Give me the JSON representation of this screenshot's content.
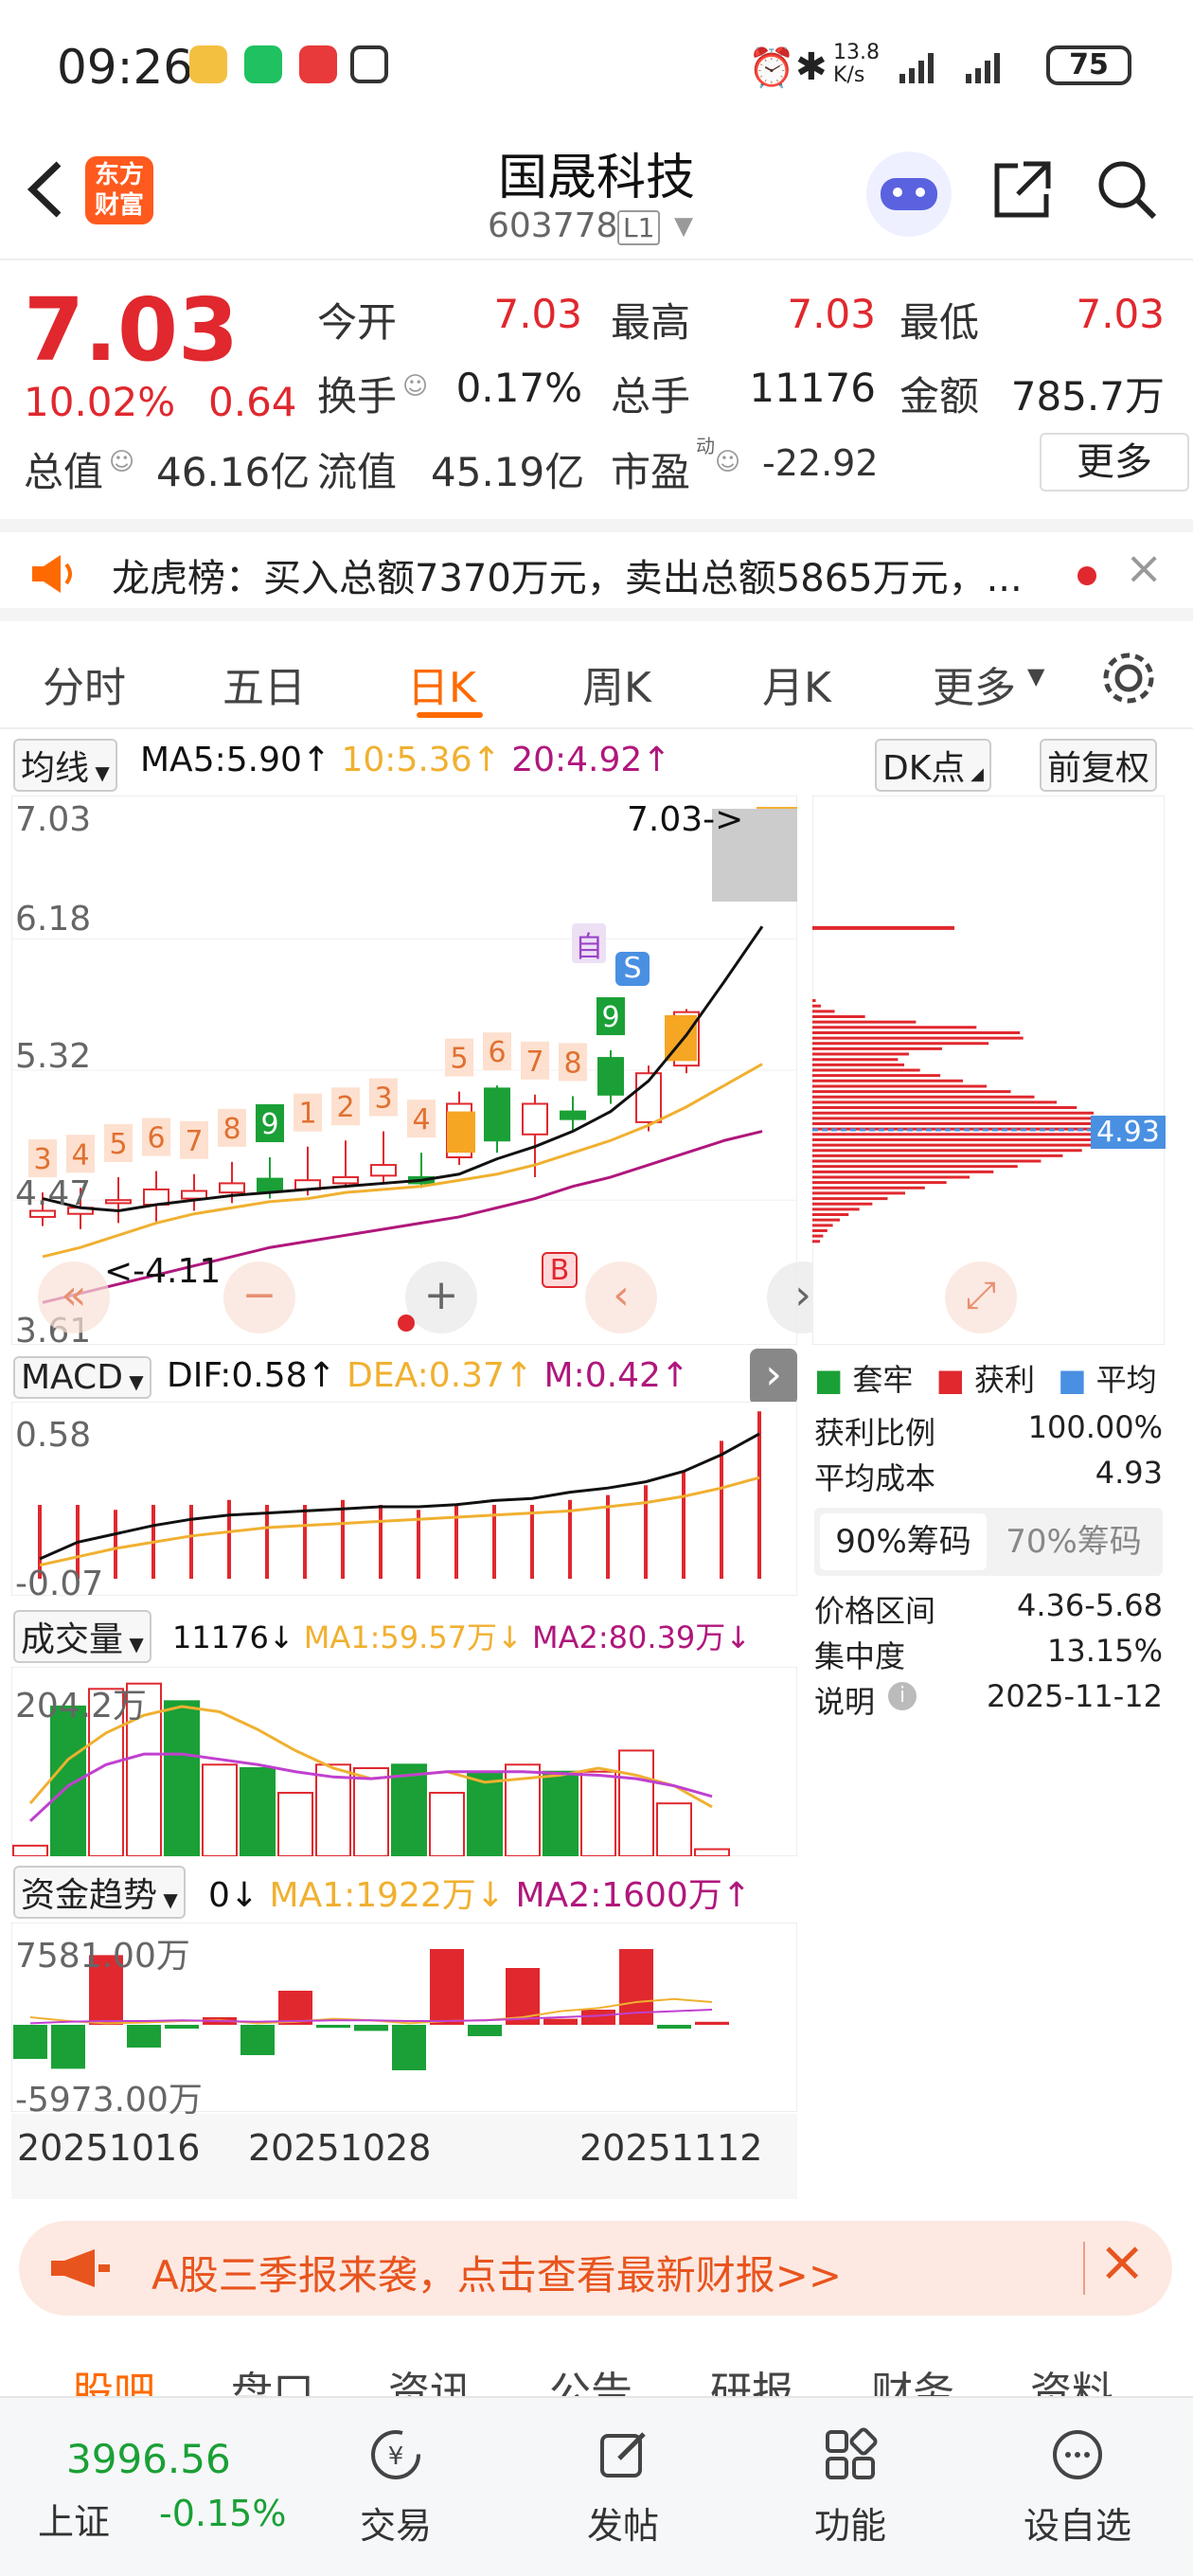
{
  "status_bar": {
    "time": "09:26",
    "net_speed": "13.8\nK/s",
    "battery": "75"
  },
  "header": {
    "logo_line1": "东方",
    "logo_line2": "财富",
    "title": "国晟科技",
    "code": "603778",
    "level": "L1"
  },
  "quote": {
    "price": "7.03",
    "change_pct": "10.02%",
    "change": "0.64",
    "open_label": "今开",
    "open": "7.03",
    "high_label": "最高",
    "high": "7.03",
    "low_label": "最低",
    "low": "7.03",
    "turnover_label": "换手",
    "turnover": "0.17%",
    "volume_label": "总手",
    "volume": "11176",
    "amount_label": "金额",
    "amount": "785.7万",
    "mcap_label": "总值",
    "mcap": "46.16亿",
    "float_label": "流值",
    "float": "45.19亿",
    "pe_label": "市盈",
    "pe_sup": "动",
    "pe": "-22.92",
    "more": "更多"
  },
  "dragon_tiger": {
    "text": "龙虎榜：买入总额7370万元，卖出总额5865万元，..."
  },
  "tabs": [
    "分时",
    "五日",
    "日K",
    "周K",
    "月K",
    "更多"
  ],
  "active_tab": "日K",
  "ma_legend": {
    "selector": "均线",
    "ma5": "MA5:5.90↑",
    "ma10": "10:5.36↑",
    "ma20": "20:4.92↑",
    "dk": "DK点",
    "fq": "前复权"
  },
  "kline": {
    "y_labels": [
      "7.03",
      "6.18",
      "5.32",
      "4.47",
      "3.61"
    ],
    "last_price_note": "7.03->",
    "low_note": "<-4.11",
    "marker_b": "B",
    "marker_s": "S",
    "marker_self": "自",
    "candles": [
      {
        "o": 4.36,
        "c": 4.4,
        "h": 4.52,
        "l": 4.3
      },
      {
        "o": 4.38,
        "c": 4.42,
        "h": 4.55,
        "l": 4.28
      },
      {
        "o": 4.45,
        "c": 4.47,
        "h": 4.62,
        "l": 4.32
      },
      {
        "o": 4.44,
        "c": 4.54,
        "h": 4.66,
        "l": 4.33
      },
      {
        "o": 4.48,
        "c": 4.53,
        "h": 4.64,
        "l": 4.4
      },
      {
        "o": 4.52,
        "c": 4.58,
        "h": 4.72,
        "l": 4.45
      },
      {
        "o": 4.61,
        "c": 4.53,
        "h": 4.75,
        "l": 4.48
      },
      {
        "o": 4.54,
        "c": 4.6,
        "h": 4.82,
        "l": 4.5
      },
      {
        "o": 4.58,
        "c": 4.62,
        "h": 4.86,
        "l": 4.55
      },
      {
        "o": 4.63,
        "c": 4.7,
        "h": 4.92,
        "l": 4.58
      },
      {
        "o": 4.62,
        "c": 4.58,
        "h": 4.78,
        "l": 4.55
      },
      {
        "o": 4.75,
        "c": 5.1,
        "h": 5.18,
        "l": 4.7
      },
      {
        "o": 5.2,
        "c": 4.86,
        "h": 5.22,
        "l": 4.78
      },
      {
        "o": 4.9,
        "c": 5.1,
        "h": 5.16,
        "l": 4.62
      },
      {
        "o": 5.05,
        "c": 5.0,
        "h": 5.15,
        "l": 4.92
      },
      {
        "o": 5.4,
        "c": 5.16,
        "h": 5.45,
        "l": 5.1
      },
      {
        "o": 4.98,
        "c": 5.3,
        "h": 5.35,
        "l": 4.92
      },
      {
        "o": 5.35,
        "c": 5.7,
        "h": 5.72,
        "l": 5.3
      },
      {
        "o": 7.03,
        "c": 7.03,
        "h": 7.03,
        "l": 7.03
      }
    ],
    "nine_turn": [
      {
        "i": 0,
        "v": "3"
      },
      {
        "i": 1,
        "v": "4"
      },
      {
        "i": 2,
        "v": "5"
      },
      {
        "i": 3,
        "v": "6"
      },
      {
        "i": 4,
        "v": "7"
      },
      {
        "i": 5,
        "v": "8"
      },
      {
        "i": 6,
        "v": "9",
        "g": true
      },
      {
        "i": 7,
        "v": "1"
      },
      {
        "i": 8,
        "v": "2"
      },
      {
        "i": 9,
        "v": "3"
      },
      {
        "i": 10,
        "v": "4"
      },
      {
        "i": 11,
        "v": "5"
      },
      {
        "i": 12,
        "v": "6"
      },
      {
        "i": 13,
        "v": "7"
      },
      {
        "i": 14,
        "v": "8"
      },
      {
        "i": 15,
        "v": "9",
        "g": true
      }
    ]
  },
  "macd": {
    "selector": "MACD",
    "dif": "DIF:0.58↑",
    "dea": "DEA:0.37↑",
    "m": "M:0.42↑",
    "y_top": "0.58",
    "y_bot": "-0.07"
  },
  "volume": {
    "selector": "成交量",
    "value": "11176↓",
    "ma1": "MA1:59.57万↓",
    "ma2": "MA2:80.39万↓",
    "y_top": "204.2万"
  },
  "fund": {
    "selector": "资金趋势",
    "value": "0↓",
    "ma1": "MA1:1922万↓",
    "ma2": "MA2:1600万↑",
    "y_top": "7581.00万",
    "y_bot": "-5973.00万"
  },
  "x_dates": [
    "20251016",
    "20251028",
    "20251112"
  ],
  "chip": {
    "avg_price": "4.93",
    "legend": [
      "套牢",
      "获利",
      "平均"
    ],
    "profit_ratio_label": "获利比例",
    "profit_ratio": "100.00%",
    "avg_cost_label": "平均成本",
    "avg_cost": "4.93",
    "tab90": "90%筹码",
    "tab70": "70%筹码",
    "range_label": "价格区间",
    "range": "4.36-5.68",
    "conc_label": "集中度",
    "conc": "13.15%",
    "note_label": "说明",
    "note_date": "2025-11-12"
  },
  "banner": {
    "text": "A股三季报来袭，点击查看最新财报>>"
  },
  "bottom_tabs": [
    "股吧",
    "盘口",
    "资讯",
    "公告",
    "研报",
    "财务",
    "资料"
  ],
  "bottom_bar": {
    "index_value": "3996.56",
    "index_name": "上证",
    "index_change": "-0.15%",
    "items": [
      "交易",
      "发帖",
      "功能",
      "设自选"
    ]
  },
  "colors": {
    "up": "#e0282e",
    "down": "#1aa036",
    "accent": "#ff6a00",
    "ma5": "#111111",
    "ma10": "#f0b030",
    "ma20": "#b0177c"
  }
}
